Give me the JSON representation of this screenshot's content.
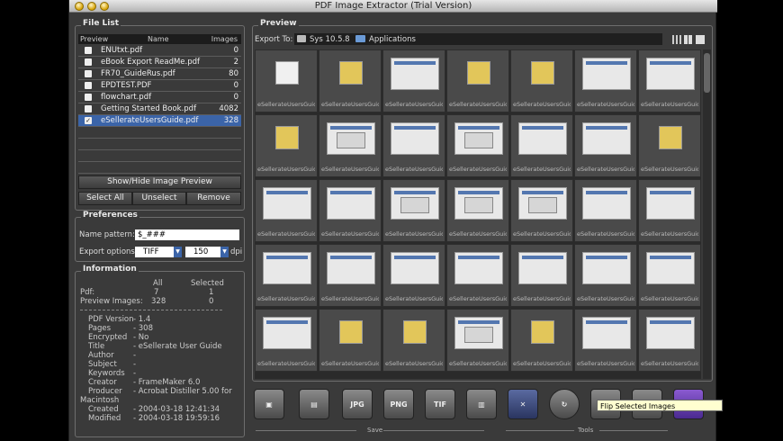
{
  "window": {
    "title": "PDF Image Extractor (Trial Version)"
  },
  "file_list": {
    "title": "File List",
    "col_preview": "Preview",
    "col_name": "Name",
    "col_images": "Images",
    "files": [
      {
        "name": "ENUtxt.pdf",
        "images": "0",
        "checked": false
      },
      {
        "name": "eBook Export ReadMe.pdf",
        "images": "2",
        "checked": false
      },
      {
        "name": "FR70_GuideRus.pdf",
        "images": "80",
        "checked": false
      },
      {
        "name": "EPDTEST.PDF",
        "images": "0",
        "checked": false
      },
      {
        "name": "flowchart.pdf",
        "images": "0",
        "checked": false
      },
      {
        "name": "Getting Started Book.pdf",
        "images": "4082",
        "checked": false
      },
      {
        "name": "eSellerateUsersGuide.pdf",
        "images": "328",
        "checked": true
      }
    ],
    "show_hide_label": "Show/Hide Image Preview",
    "select_all_label": "Select All",
    "unselect_label": "Unselect",
    "remove_label": "Remove"
  },
  "preferences": {
    "title": "Preferences",
    "name_pattern_label": "Name pattern:",
    "name_pattern_value": "$_###",
    "export_options_label": "Export options:",
    "format_value": "TIFF",
    "dpi_value": "150",
    "dpi_unit": "dpi"
  },
  "information": {
    "title": "Information",
    "col_all": "All",
    "col_selected": "Selected",
    "pdf_label": "Pdf:",
    "pdf_all": "7",
    "pdf_selected": "1",
    "preview_label": "Preview Images:",
    "preview_all": "328",
    "preview_selected": "0",
    "meta": [
      {
        "k": "PDF Version",
        "v": "- 1.4"
      },
      {
        "k": "Pages",
        "v": "- 308"
      },
      {
        "k": "Encrypted",
        "v": "- No"
      },
      {
        "k": "Title",
        "v": "- eSellerate User Guide"
      },
      {
        "k": "Author",
        "v": "-"
      },
      {
        "k": "Subject",
        "v": "-"
      },
      {
        "k": "Keywords",
        "v": "-"
      },
      {
        "k": "Creator",
        "v": "- FrameMaker 6.0"
      },
      {
        "k": "Producer",
        "v": "- Acrobat Distiller 5.00 for"
      },
      {
        "k": "Macintosh",
        "v": ""
      },
      {
        "k": "Created",
        "v": "- 2004-03-18 12:41:34"
      },
      {
        "k": "Modified",
        "v": "- 2004-03-18 19:59:16"
      }
    ]
  },
  "preview": {
    "title": "Preview",
    "export_to_label": "Export To:",
    "drive_label": "Sys 10.5.8",
    "folder_label": "Applications",
    "thumb_caption": "eSellerateUsersGuide_"
  },
  "toolbar": {
    "save_label": "Save",
    "tools_label": "Tools",
    "jpg_label": "JPG",
    "png_label": "PNG",
    "tif_label": "TIF",
    "tooltip": "Flip Selected Images"
  },
  "colors": {
    "selection": "#3b64a8",
    "background": "#3a3a3a"
  }
}
